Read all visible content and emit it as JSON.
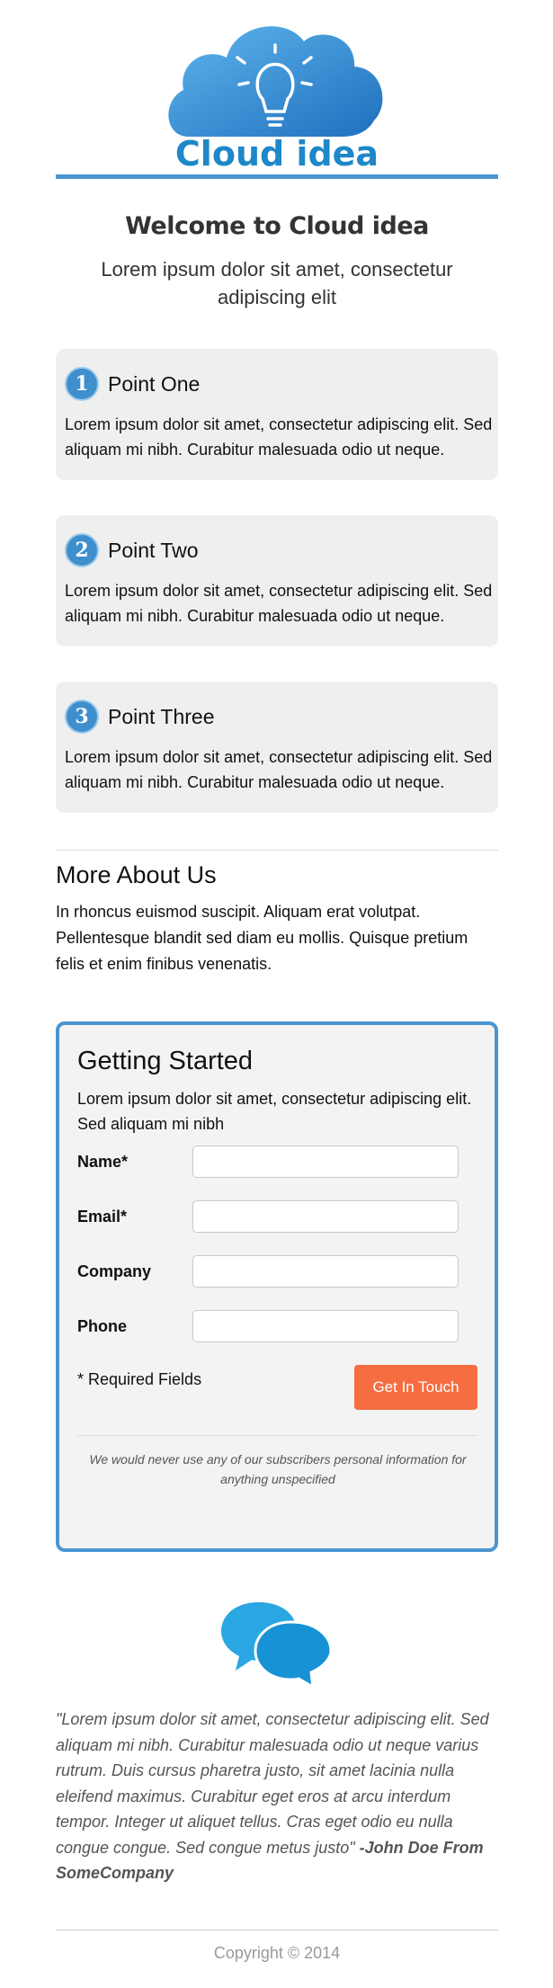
{
  "header": {
    "logo_text": "Cloud idea"
  },
  "welcome": {
    "title": "Welcome to Cloud idea",
    "subtitle": "Lorem ipsum dolor sit amet, consectetur adipiscing elit"
  },
  "points": [
    {
      "number": "1",
      "title": "Point One",
      "body": "Lorem ipsum dolor sit amet, consectetur adipiscing elit. Sed aliquam mi nibh. Curabitur malesuada odio ut neque."
    },
    {
      "number": "2",
      "title": "Point Two",
      "body": "Lorem ipsum dolor sit amet, consectetur adipiscing elit. Sed aliquam mi nibh. Curabitur malesuada odio ut neque."
    },
    {
      "number": "3",
      "title": "Point Three",
      "body": "Lorem ipsum dolor sit amet, consectetur adipiscing elit. Sed aliquam mi nibh. Curabitur malesuada odio ut neque."
    }
  ],
  "about": {
    "title": "More About Us",
    "body": "In rhoncus euismod suscipit. Aliquam erat volutpat. Pellentesque blandit sed diam eu mollis. Quisque pretium felis et enim finibus venenatis."
  },
  "form": {
    "title": "Getting Started",
    "description": "Lorem ipsum dolor sit amet, consectetur adipiscing elit. Sed aliquam mi nibh",
    "fields": [
      {
        "label": "Name*",
        "value": "",
        "placeholder": ""
      },
      {
        "label": "Email*",
        "value": "",
        "placeholder": ""
      },
      {
        "label": "Company",
        "value": "",
        "placeholder": ""
      },
      {
        "label": "Phone",
        "value": "",
        "placeholder": ""
      }
    ],
    "required_note": "* Required Fields",
    "submit_label": "Get In Touch",
    "privacy_note": "We would never use any of our subscribers personal information for anything unspecified"
  },
  "testimonial": {
    "quote": "\"Lorem ipsum dolor sit amet, consectetur adipiscing elit. Sed aliquam mi nibh. Curabitur malesuada odio ut neque varius rutrum. Duis cursus pharetra justo, sit amet lacinia nulla eleifend maximus. Curabitur eget eros at arcu interdum tempor. Integer ut aliquet tellus. Cras eget odio eu nulla congue congue. Sed congue metus justo\"",
    "author": "-John Doe From SomeCompany"
  },
  "footer": {
    "copyright": "Copyright © 2014"
  },
  "colors": {
    "brand_blue": "#4a96d2",
    "cta_orange": "#f56d41",
    "card_gray": "#efefef"
  },
  "icons": {
    "logo": "cloud-lightbulb-icon",
    "testimonial": "chat-bubbles-icon"
  }
}
